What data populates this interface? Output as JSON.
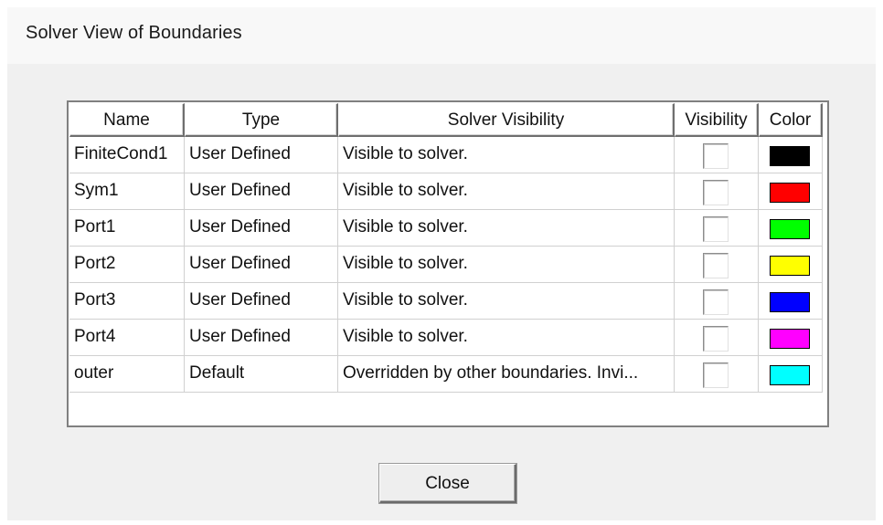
{
  "window": {
    "title": "Solver View of Boundaries"
  },
  "table": {
    "columns": [
      "Name",
      "Type",
      "Solver Visibility",
      "Visibility",
      "Color"
    ],
    "rows": [
      {
        "name": "FiniteCond1",
        "type": "User Defined",
        "solver_visibility": "Visible to solver.",
        "visibility": false,
        "color": "#000000"
      },
      {
        "name": "Sym1",
        "type": "User Defined",
        "solver_visibility": "Visible to solver.",
        "visibility": false,
        "color": "#ff0000"
      },
      {
        "name": "Port1",
        "type": "User Defined",
        "solver_visibility": "Visible to solver.",
        "visibility": false,
        "color": "#00ff00"
      },
      {
        "name": "Port2",
        "type": "User Defined",
        "solver_visibility": "Visible to solver.",
        "visibility": false,
        "color": "#ffff00"
      },
      {
        "name": "Port3",
        "type": "User Defined",
        "solver_visibility": "Visible to solver.",
        "visibility": false,
        "color": "#0000ff"
      },
      {
        "name": "Port4",
        "type": "User Defined",
        "solver_visibility": "Visible to solver.",
        "visibility": false,
        "color": "#ff00ff"
      },
      {
        "name": "outer",
        "type": "Default",
        "solver_visibility": "Overridden by other boundaries. Invi...",
        "visibility": false,
        "color": "#00ffff"
      }
    ]
  },
  "buttons": {
    "close_label": "Close"
  }
}
